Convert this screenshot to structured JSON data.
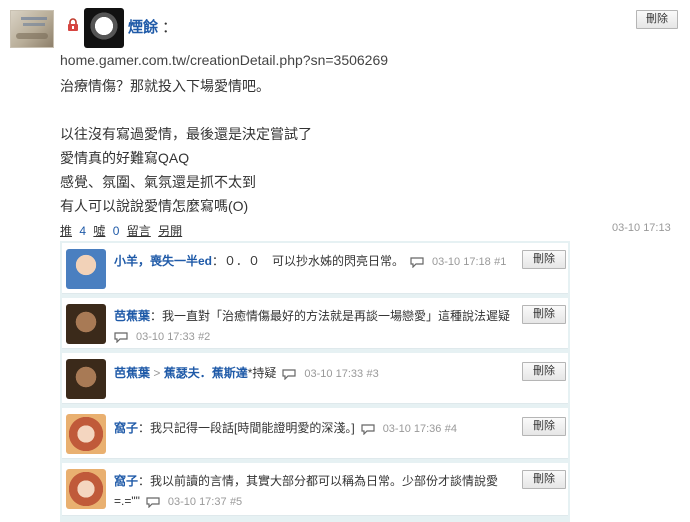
{
  "post": {
    "author": "煙餘",
    "colon": "：",
    "delete_label": "刪除",
    "lines": [
      "home.gamer.com.tw/creationDetail.php?sn=3506269",
      "治療情傷？那就投入下場愛情吧。",
      "",
      "以往沒有寫過愛情，最後還是決定嘗試了",
      "愛情真的好難寫QAQ",
      "感覺、氛圍、氣氛還是抓不太到",
      "有人可以說說愛情怎麼寫嗎(O)"
    ],
    "actions": {
      "push_label": "推",
      "push_count": "4",
      "boo_label": "噓",
      "boo_count": "0",
      "comment_label": "留言",
      "share_label": "另開"
    },
    "time": "03-10 17:13"
  },
  "comments": [
    {
      "name": "小羊，喪失一半ed",
      "reply_to": "",
      "text": "：０．０　可以抄水姊的閃亮日常。",
      "time": "03-10 17:18",
      "num": "#1",
      "delete_label": "刪除",
      "avatar_color": "#4a7fc0"
    },
    {
      "name": "芭蕉葉",
      "reply_to": "",
      "text": "：我一直對「治癒情傷最好的方法就是再談一場戀愛」這種說法遲疑",
      "time": "03-10 17:33",
      "num": "#2",
      "delete_label": "刪除",
      "avatar_color": "#6b4a2e"
    },
    {
      "name": "芭蕉葉",
      "reply_to": "蕉瑟夫．蕉斯達",
      "reply_sep": ">",
      "text": "*持疑",
      "time": "03-10 17:33",
      "num": "#3",
      "delete_label": "刪除",
      "avatar_color": "#6b4a2e"
    },
    {
      "name": "窩子",
      "reply_to": "",
      "text": "：我只記得一段話[時間能證明愛的深淺。]",
      "time": "03-10 17:36",
      "num": "#4",
      "delete_label": "刪除",
      "avatar_color": "#c05a3a"
    },
    {
      "name": "窩子",
      "reply_to": "",
      "text": "：我以前讀的言情，其實大部分都可以稱為日常。少部份才談情說愛",
      "text2": "=.=\"\"",
      "time": "03-10 17:37",
      "num": "#5",
      "delete_label": "刪除",
      "avatar_color": "#c05a3a"
    }
  ]
}
